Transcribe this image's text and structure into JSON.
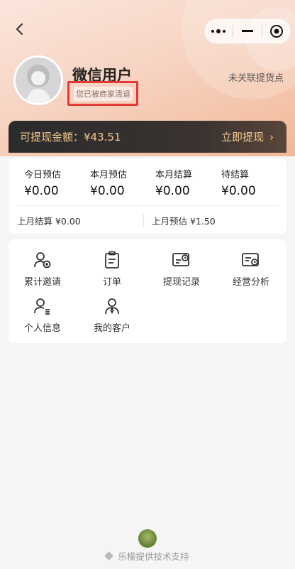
{
  "header": {
    "user_name": "微信用户",
    "status_tag": "您已被商家清退",
    "link_store": "未关联提货点"
  },
  "withdraw": {
    "amount_text": "可提现金额：¥43.51",
    "action_label": "立即提现",
    "action_chevron": "›"
  },
  "stats": [
    {
      "label": "今日预估",
      "value": "¥0.00"
    },
    {
      "label": "本月预估",
      "value": "¥0.00"
    },
    {
      "label": "本月结算",
      "value": "¥0.00"
    },
    {
      "label": "待结算",
      "value": "¥0.00"
    }
  ],
  "sub_stats": [
    {
      "text": "上月结算  ¥0.00"
    },
    {
      "text": "上月预估  ¥1.50"
    }
  ],
  "menu": [
    {
      "label": "累计邀请",
      "icon": "invite-icon"
    },
    {
      "label": "订单",
      "icon": "order-icon"
    },
    {
      "label": "提现记录",
      "icon": "withdraw-record-icon"
    },
    {
      "label": "经营分析",
      "icon": "analysis-icon"
    },
    {
      "label": "个人信息",
      "icon": "profile-icon"
    },
    {
      "label": "我的客户",
      "icon": "customers-icon"
    }
  ],
  "footer": {
    "text": "乐檬提供技术支持"
  },
  "colors": {
    "accent_gold": "#f4c890",
    "highlight_red": "#e53935",
    "hero_gradient_end": "#f2b896"
  }
}
